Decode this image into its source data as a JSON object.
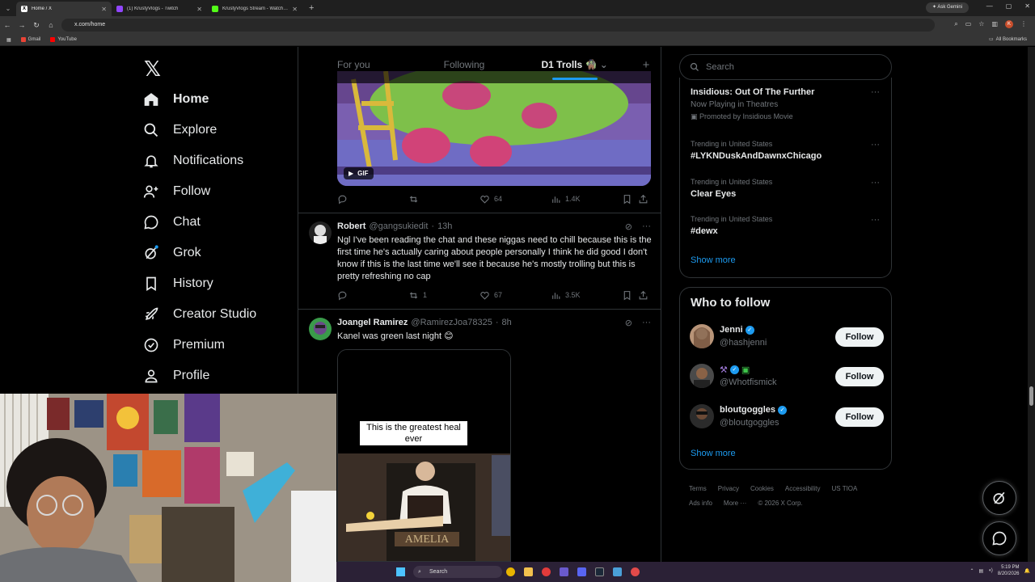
{
  "browser": {
    "tabs": [
      {
        "label": "Home / X",
        "active": true,
        "icon": "x-logo-icon",
        "color": "#ffffff"
      },
      {
        "label": "(1) KrustyVlogs - Twitch",
        "active": false,
        "icon": "twitch-icon",
        "color": "#9146ff"
      },
      {
        "label": "KrustyVlogs Stream - Watch Li...",
        "active": false,
        "icon": "kick-icon",
        "color": "#53fc18"
      }
    ],
    "ask_gemini": "Ask Gemini",
    "url": "x.com/home",
    "bookmarks": [
      {
        "label": "Gmail",
        "color": "#ea4335"
      },
      {
        "label": "YouTube",
        "color": "#ff0000"
      }
    ],
    "all_bookmarks": "All Bookmarks",
    "profile_initial": "K"
  },
  "nav": {
    "items": [
      {
        "label": "Home",
        "icon": "home-icon"
      },
      {
        "label": "Explore",
        "icon": "search-icon"
      },
      {
        "label": "Notifications",
        "icon": "bell-icon"
      },
      {
        "label": "Follow",
        "icon": "add-person-icon"
      },
      {
        "label": "Chat",
        "icon": "chat-icon"
      },
      {
        "label": "Grok",
        "icon": "grok-icon"
      },
      {
        "label": "History",
        "icon": "bookmark-icon"
      },
      {
        "label": "Creator Studio",
        "icon": "rocket-icon"
      },
      {
        "label": "Premium",
        "icon": "verified-icon"
      },
      {
        "label": "Profile",
        "icon": "person-icon"
      }
    ]
  },
  "feed": {
    "tabs": [
      "For you",
      "Following",
      "D1 Trolls 🧌"
    ],
    "active_tab": "D1 Trolls 🧌",
    "gif_label": "GIF",
    "post1_actions": {
      "replies": "",
      "reposts": "",
      "likes": "64",
      "views": "1.4K"
    },
    "post2": {
      "name": "Robert",
      "handle": "@gangsukiedit",
      "time": "13h",
      "text": "Ngl I've been reading the chat and these niggas need to chill because this is the first time he's actually caring about people personally I think he did good I don't know if this is the last time we'll see it because he's mostly trolling but this is pretty refreshing no cap",
      "replies": "",
      "reposts": "1",
      "likes": "67",
      "views": "3.5K"
    },
    "post3": {
      "name": "Joangel Ramirez",
      "handle": "@RamirezJoa78325",
      "time": "8h",
      "text": "Kanel was green last night 😊",
      "video_caption": "This is the greatest heal ever"
    }
  },
  "sidebar": {
    "search_placeholder": "Search",
    "trends": [
      {
        "context": "",
        "title": "Insidious: Out Of The Further",
        "sub": "Now Playing in Theatres",
        "promo": "Promoted by Insidious Movie"
      },
      {
        "context": "Trending in United States",
        "title": "#LYKNDuskAndDawnxChicago"
      },
      {
        "context": "Trending in United States",
        "title": "Clear Eyes"
      },
      {
        "context": "Trending in United States",
        "title": "#dewx"
      }
    ],
    "show_more": "Show more",
    "who_to_follow": {
      "title": "Who to follow",
      "users": [
        {
          "name": "Jenni",
          "handle": "@hashjenni",
          "verified": true,
          "button": "Follow"
        },
        {
          "name": "",
          "handle": "@Whotfismick",
          "verified": true,
          "button": "Follow"
        },
        {
          "name": "bloutgoggles",
          "handle": "@bloutgoggles",
          "verified": true,
          "button": "Follow"
        }
      ],
      "show_more": "Show more"
    },
    "footer": {
      "links": [
        "Terms",
        "Privacy",
        "Cookies",
        "Accessibility",
        "US TIOA",
        "Ads info",
        "More ···"
      ],
      "copyright": "© 2026 X Corp."
    }
  },
  "taskbar": {
    "search": "Search",
    "time": "5:19 PM",
    "date": "8/20/2026"
  },
  "colors": {
    "accent": "#1d9bf0",
    "border": "#2f3336",
    "muted": "#71767b"
  }
}
